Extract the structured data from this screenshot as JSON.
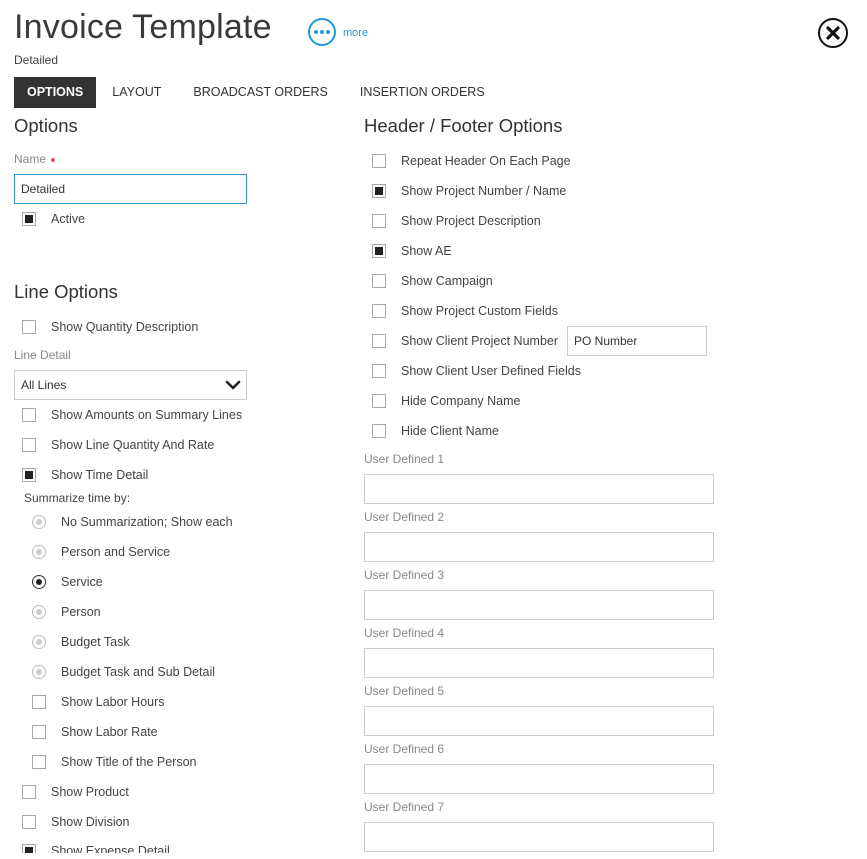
{
  "header": {
    "title": "Invoice Template",
    "subtitle": "Detailed",
    "more_label": "more",
    "more_icon": "ellipsis-icon",
    "close_icon": "close-icon"
  },
  "tabs": [
    {
      "label": "OPTIONS",
      "active": true
    },
    {
      "label": "LAYOUT",
      "active": false
    },
    {
      "label": "BROADCAST ORDERS",
      "active": false
    },
    {
      "label": "INSERTION ORDERS",
      "active": false
    }
  ],
  "options": {
    "heading": "Options",
    "name_label": "Name",
    "name_value": "Detailed",
    "active_label": "Active",
    "active_checked": true
  },
  "line_options": {
    "heading": "Line Options",
    "show_quantity_description": "Show Quantity Description",
    "line_detail_label": "Line Detail",
    "line_detail_value": "All Lines",
    "show_amounts_summary": "Show Amounts on Summary Lines",
    "show_line_quantity_rate": "Show Line Quantity And Rate",
    "show_time_detail": "Show Time Detail",
    "summarize_label": "Summarize time by:",
    "summarize_options": [
      {
        "label": "No Summarization; Show each",
        "selected": false
      },
      {
        "label": "Person and Service",
        "selected": false
      },
      {
        "label": "Service",
        "selected": true
      },
      {
        "label": "Person",
        "selected": false
      },
      {
        "label": "Budget Task",
        "selected": false
      },
      {
        "label": "Budget Task and Sub Detail",
        "selected": false
      }
    ],
    "show_labor_hours": "Show Labor Hours",
    "show_labor_rate": "Show Labor Rate",
    "show_title_person": "Show Title of the Person",
    "show_product": "Show Product",
    "show_division": "Show Division",
    "show_expense_detail": "Show Expense Detail"
  },
  "header_footer": {
    "heading": "Header / Footer Options",
    "items": [
      {
        "label": "Repeat Header On Each Page",
        "checked": false
      },
      {
        "label": "Show Project Number / Name",
        "checked": true
      },
      {
        "label": "Show Project Description",
        "checked": false
      },
      {
        "label": "Show AE",
        "checked": true
      },
      {
        "label": "Show Campaign",
        "checked": false
      },
      {
        "label": "Show Project Custom Fields",
        "checked": false
      },
      {
        "label": "Show Client Project Number",
        "checked": false
      },
      {
        "label": "Show Client User Defined Fields",
        "checked": false
      },
      {
        "label": "Hide Company Name",
        "checked": false
      },
      {
        "label": "Hide Client Name",
        "checked": false
      }
    ],
    "po_number_value": "PO Number",
    "user_defined": [
      {
        "label": "User Defined 1",
        "value": ""
      },
      {
        "label": "User Defined 2",
        "value": ""
      },
      {
        "label": "User Defined 3",
        "value": ""
      },
      {
        "label": "User Defined 4",
        "value": ""
      },
      {
        "label": "User Defined 5",
        "value": ""
      },
      {
        "label": "User Defined 6",
        "value": ""
      },
      {
        "label": "User Defined 7",
        "value": ""
      }
    ]
  },
  "colors": {
    "accent": "#1b9bd7",
    "tab_active_bg": "#333333",
    "focus_border": "#3a94c4",
    "required": "#d9534f"
  }
}
